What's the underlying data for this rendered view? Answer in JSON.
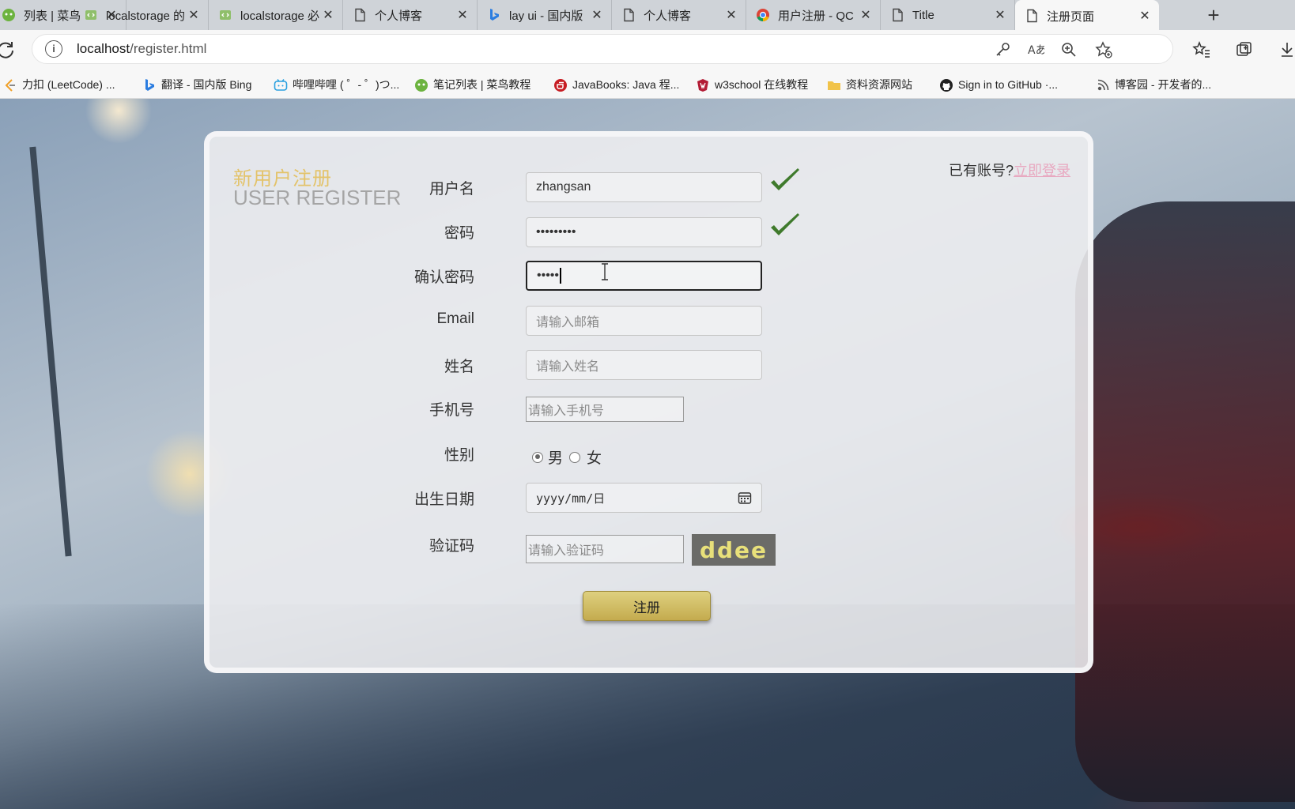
{
  "browser": {
    "tabs": [
      {
        "label": "列表 | 菜鸟",
        "icon": "runoob-icon"
      },
      {
        "label": "localstorage 的",
        "icon": "code-page-icon"
      },
      {
        "label": "localstorage 必",
        "icon": "code-page-icon"
      },
      {
        "label": "个人博客",
        "icon": "page-icon"
      },
      {
        "label": "lay ui - 国内版",
        "icon": "bing-icon"
      },
      {
        "label": "个人博客",
        "icon": "page-icon"
      },
      {
        "label": "用户注册 - QC",
        "icon": "chrome-icon"
      },
      {
        "label": "Title",
        "icon": "page-icon"
      },
      {
        "label": "注册页面",
        "icon": "page-icon"
      }
    ],
    "active_tab_index": 8,
    "close_glyph": "✕",
    "new_tab_glyph": "+",
    "url_host": "localhost",
    "url_path": "/register.html",
    "bookmarks": [
      {
        "label": "力扣 (LeetCode) ...",
        "icon": "leetcode-icon",
        "color": "#f0a028"
      },
      {
        "label": "翻译 - 国内版 Bing",
        "icon": "bing-icon",
        "color": "#2b7de0"
      },
      {
        "label": "哔哩哔哩 ( ゜- ゜)つ...",
        "icon": "bilibili-icon",
        "color": "#2aa1e0"
      },
      {
        "label": "笔记列表 | 菜鸟教程",
        "icon": "runoob-icon",
        "color": "#6cb33f"
      },
      {
        "label": "JavaBooks: Java 程...",
        "icon": "gitee-icon",
        "color": "#c71d23"
      },
      {
        "label": "w3school 在线教程",
        "icon": "w3school-icon",
        "color": "#b31b34"
      },
      {
        "label": "资料资源网站",
        "icon": "folder-icon",
        "color": "#f1c34a"
      },
      {
        "label": "Sign in to GitHub ·...",
        "icon": "github-icon",
        "color": "#222222"
      },
      {
        "label": "博客园 - 开发者的...",
        "icon": "cnblogs-icon",
        "color": "#555555"
      }
    ]
  },
  "panel": {
    "title_cn": "新用户注册",
    "title_en": "USER REGISTER",
    "login_prompt": "已有账号?",
    "login_link": "立即登录"
  },
  "form": {
    "username": {
      "label": "用户名",
      "value": "zhangsan"
    },
    "password": {
      "label": "密码",
      "value": "•••••••••"
    },
    "confirm_password": {
      "label": "确认密码",
      "value": "•••••"
    },
    "email": {
      "label": "Email",
      "placeholder": "请输入邮箱"
    },
    "name": {
      "label": "姓名",
      "placeholder": "请输入姓名"
    },
    "phone": {
      "label": "手机号",
      "placeholder": "请输入手机号"
    },
    "gender": {
      "label": "性别",
      "male": "男",
      "female": "女",
      "selected": "男"
    },
    "birthday": {
      "label": "出生日期",
      "placeholder": "yyyy/mm/日"
    },
    "captcha": {
      "label": "验证码",
      "placeholder": "请输入验证码",
      "code": "ddee"
    },
    "submit_label": "注册"
  },
  "colors": {
    "accent_gold": "#e3c36a",
    "check_green": "#3f7a2c",
    "link_pink": "#e8a8c0",
    "captcha_text": "#e8e07a"
  }
}
